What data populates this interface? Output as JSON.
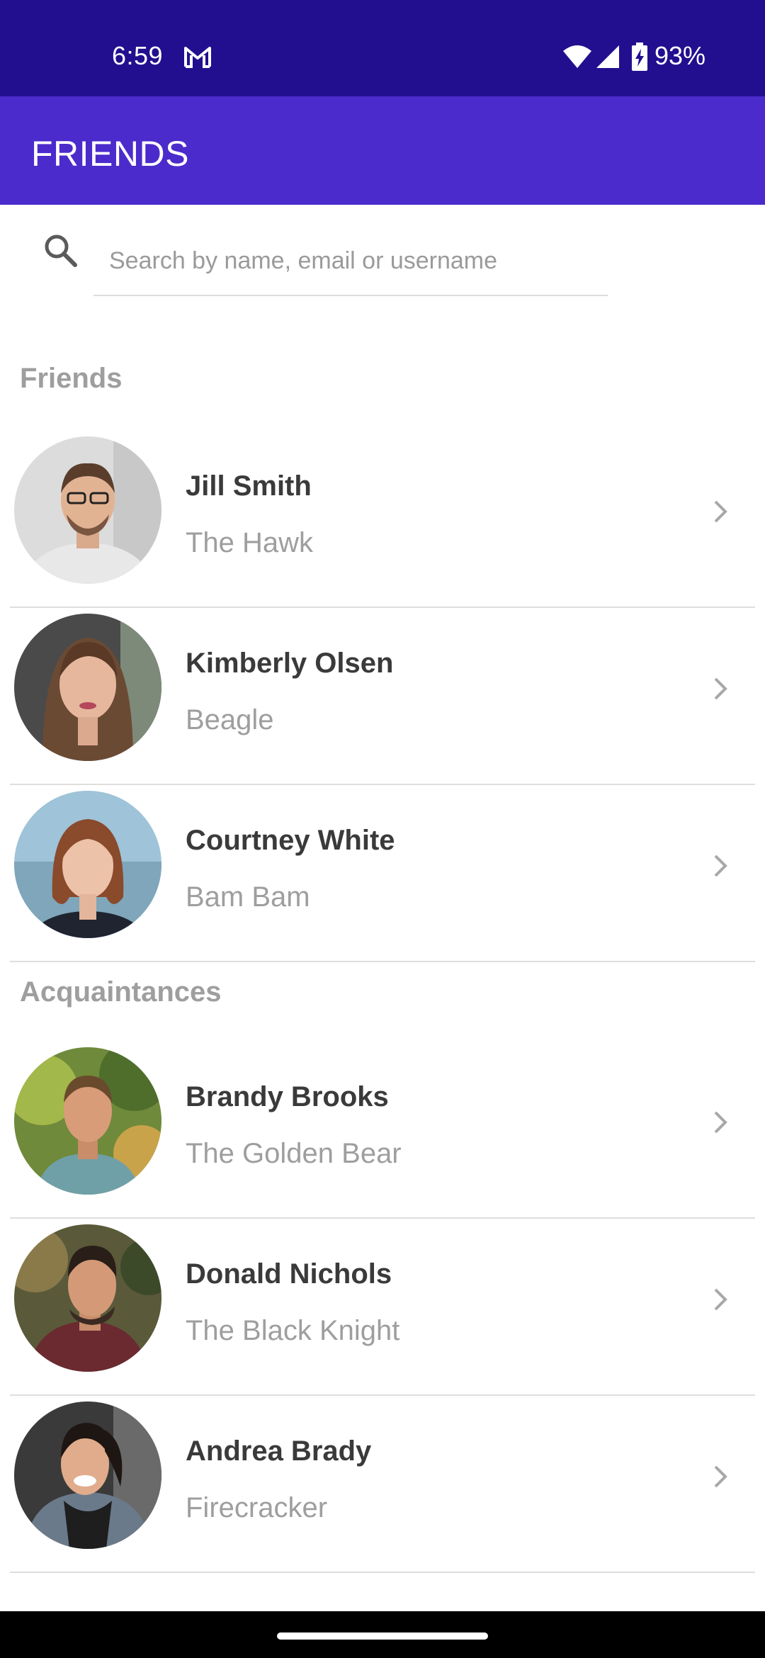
{
  "status_bar": {
    "time": "6:59",
    "battery": "93%",
    "icons": [
      "gmail-icon",
      "wifi-icon",
      "signal-icon",
      "battery-charging-icon"
    ]
  },
  "app_bar": {
    "title": "FRIENDS",
    "color": "#4b2bcc"
  },
  "search": {
    "placeholder": "Search by name, email or username",
    "value": ""
  },
  "sections": [
    {
      "title": "Friends",
      "items": [
        {
          "name": "Jill Smith",
          "nickname": "The Hawk"
        },
        {
          "name": "Kimberly Olsen",
          "nickname": "Beagle"
        },
        {
          "name": "Courtney White",
          "nickname": "Bam Bam"
        }
      ]
    },
    {
      "title": "Acquaintances",
      "items": [
        {
          "name": "Brandy Brooks",
          "nickname": "The Golden Bear"
        },
        {
          "name": "Donald Nichols",
          "nickname": "The Black Knight"
        },
        {
          "name": "Andrea Brady",
          "nickname": "Firecracker"
        }
      ]
    }
  ],
  "colors": {
    "status_bar": "#220f8f",
    "accent": "#4b2bcc",
    "name_text": "#3a3a3a",
    "secondary_text": "#9e9e9e"
  }
}
